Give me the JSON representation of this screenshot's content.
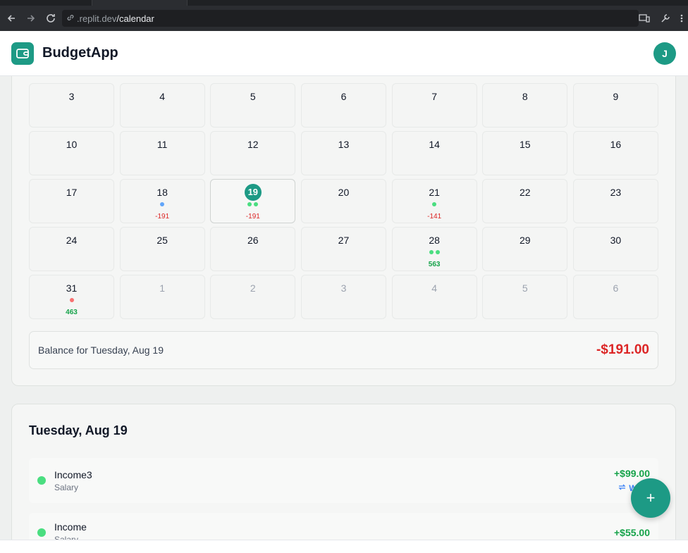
{
  "browser": {
    "url_host": ".replit.dev",
    "url_path": "/calendar"
  },
  "header": {
    "app_name": "BudgetApp",
    "avatar_initial": "J"
  },
  "calendar": {
    "weeks": [
      [
        {
          "day": "3"
        },
        {
          "day": "4"
        },
        {
          "day": "5"
        },
        {
          "day": "6"
        },
        {
          "day": "7"
        },
        {
          "day": "8"
        },
        {
          "day": "9"
        }
      ],
      [
        {
          "day": "10"
        },
        {
          "day": "11"
        },
        {
          "day": "12"
        },
        {
          "day": "13"
        },
        {
          "day": "14"
        },
        {
          "day": "15"
        },
        {
          "day": "16"
        }
      ],
      [
        {
          "day": "17"
        },
        {
          "day": "18",
          "dots": [
            "#60a5fa"
          ],
          "amount": "-191",
          "amount_type": "neg"
        },
        {
          "day": "19",
          "selected": true,
          "dots": [
            "#4ade80",
            "#4ade80"
          ],
          "amount": "-191",
          "amount_type": "neg"
        },
        {
          "day": "20"
        },
        {
          "day": "21",
          "dots": [
            "#4ade80"
          ],
          "amount": "-141",
          "amount_type": "neg"
        },
        {
          "day": "22"
        },
        {
          "day": "23"
        }
      ],
      [
        {
          "day": "24"
        },
        {
          "day": "25"
        },
        {
          "day": "26"
        },
        {
          "day": "27"
        },
        {
          "day": "28",
          "dots": [
            "#4ade80",
            "#4ade80"
          ],
          "amount": "563",
          "amount_type": "pos"
        },
        {
          "day": "29"
        },
        {
          "day": "30"
        }
      ],
      [
        {
          "day": "31",
          "dots": [
            "#f87171"
          ],
          "amount": "463",
          "amount_type": "pos"
        },
        {
          "day": "1",
          "other": true
        },
        {
          "day": "2",
          "other": true
        },
        {
          "day": "3",
          "other": true
        },
        {
          "day": "4",
          "other": true
        },
        {
          "day": "5",
          "other": true
        },
        {
          "day": "6",
          "other": true
        }
      ]
    ],
    "balance_label": "Balance for Tuesday, Aug 19",
    "balance_value": "-$191.00"
  },
  "day_detail": {
    "title": "Tuesday, Aug 19",
    "transactions": [
      {
        "name": "Income3",
        "category": "Salary",
        "amount": "+$99.00",
        "recurrence": "We"
      },
      {
        "name": "Income",
        "category": "Salary",
        "amount": "+$55.00"
      }
    ]
  },
  "fab": {
    "label": "+"
  },
  "colors": {
    "accent": "#1d9a85",
    "negative": "#dc2626",
    "positive": "#16a34a"
  }
}
